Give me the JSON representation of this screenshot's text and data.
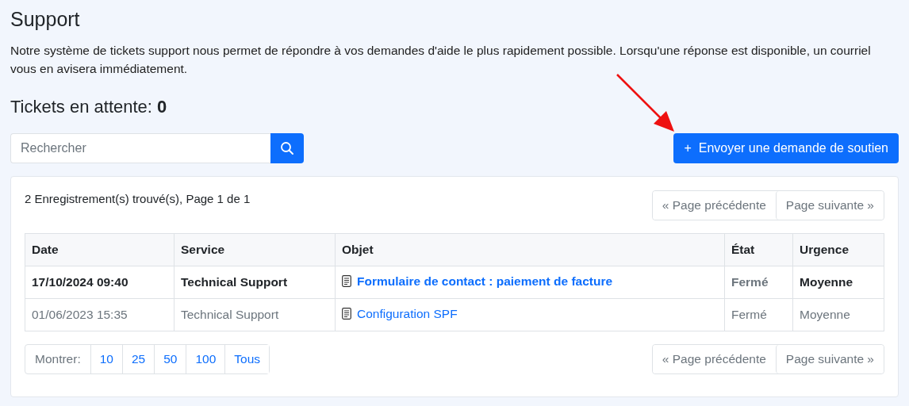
{
  "title": "Support",
  "description": "Notre système de tickets support nous permet de répondre à vos demandes d'aide le plus rapidement possible. Lorsqu'une réponse est disponible, un courriel vous en avisera immédiatement.",
  "pending": {
    "label": "Tickets en attente:",
    "count": "0"
  },
  "search": {
    "placeholder": "Rechercher"
  },
  "new_button": {
    "icon": "+",
    "label": "Envoyer une demande de soutien"
  },
  "results": "2 Enregistrement(s) trouvé(s), Page 1 de 1",
  "pager_top": [
    {
      "label": "« Page précédente",
      "disabled": true
    },
    {
      "label": "Page suivante »",
      "disabled": true
    }
  ],
  "table": {
    "columns": [
      "Date",
      "Service",
      "Objet",
      "État",
      "Urgence"
    ],
    "rows": [
      {
        "unread": true,
        "date": "17/10/2024 09:40",
        "service": "Technical Support",
        "subject": "Formulaire de contact : paiement de facture",
        "state": "Fermé",
        "urgency": "Moyenne"
      },
      {
        "unread": false,
        "date": "01/06/2023 15:35",
        "service": "Technical Support",
        "subject": "Configuration SPF",
        "state": "Fermé",
        "urgency": "Moyenne"
      }
    ]
  },
  "show": {
    "label": "Montrer:",
    "options": [
      "10",
      "25",
      "50",
      "100",
      "Tous"
    ]
  },
  "pager_bottom": [
    {
      "label": "« Page précédente",
      "disabled": true
    },
    {
      "label": "Page suivante »",
      "disabled": true
    }
  ]
}
